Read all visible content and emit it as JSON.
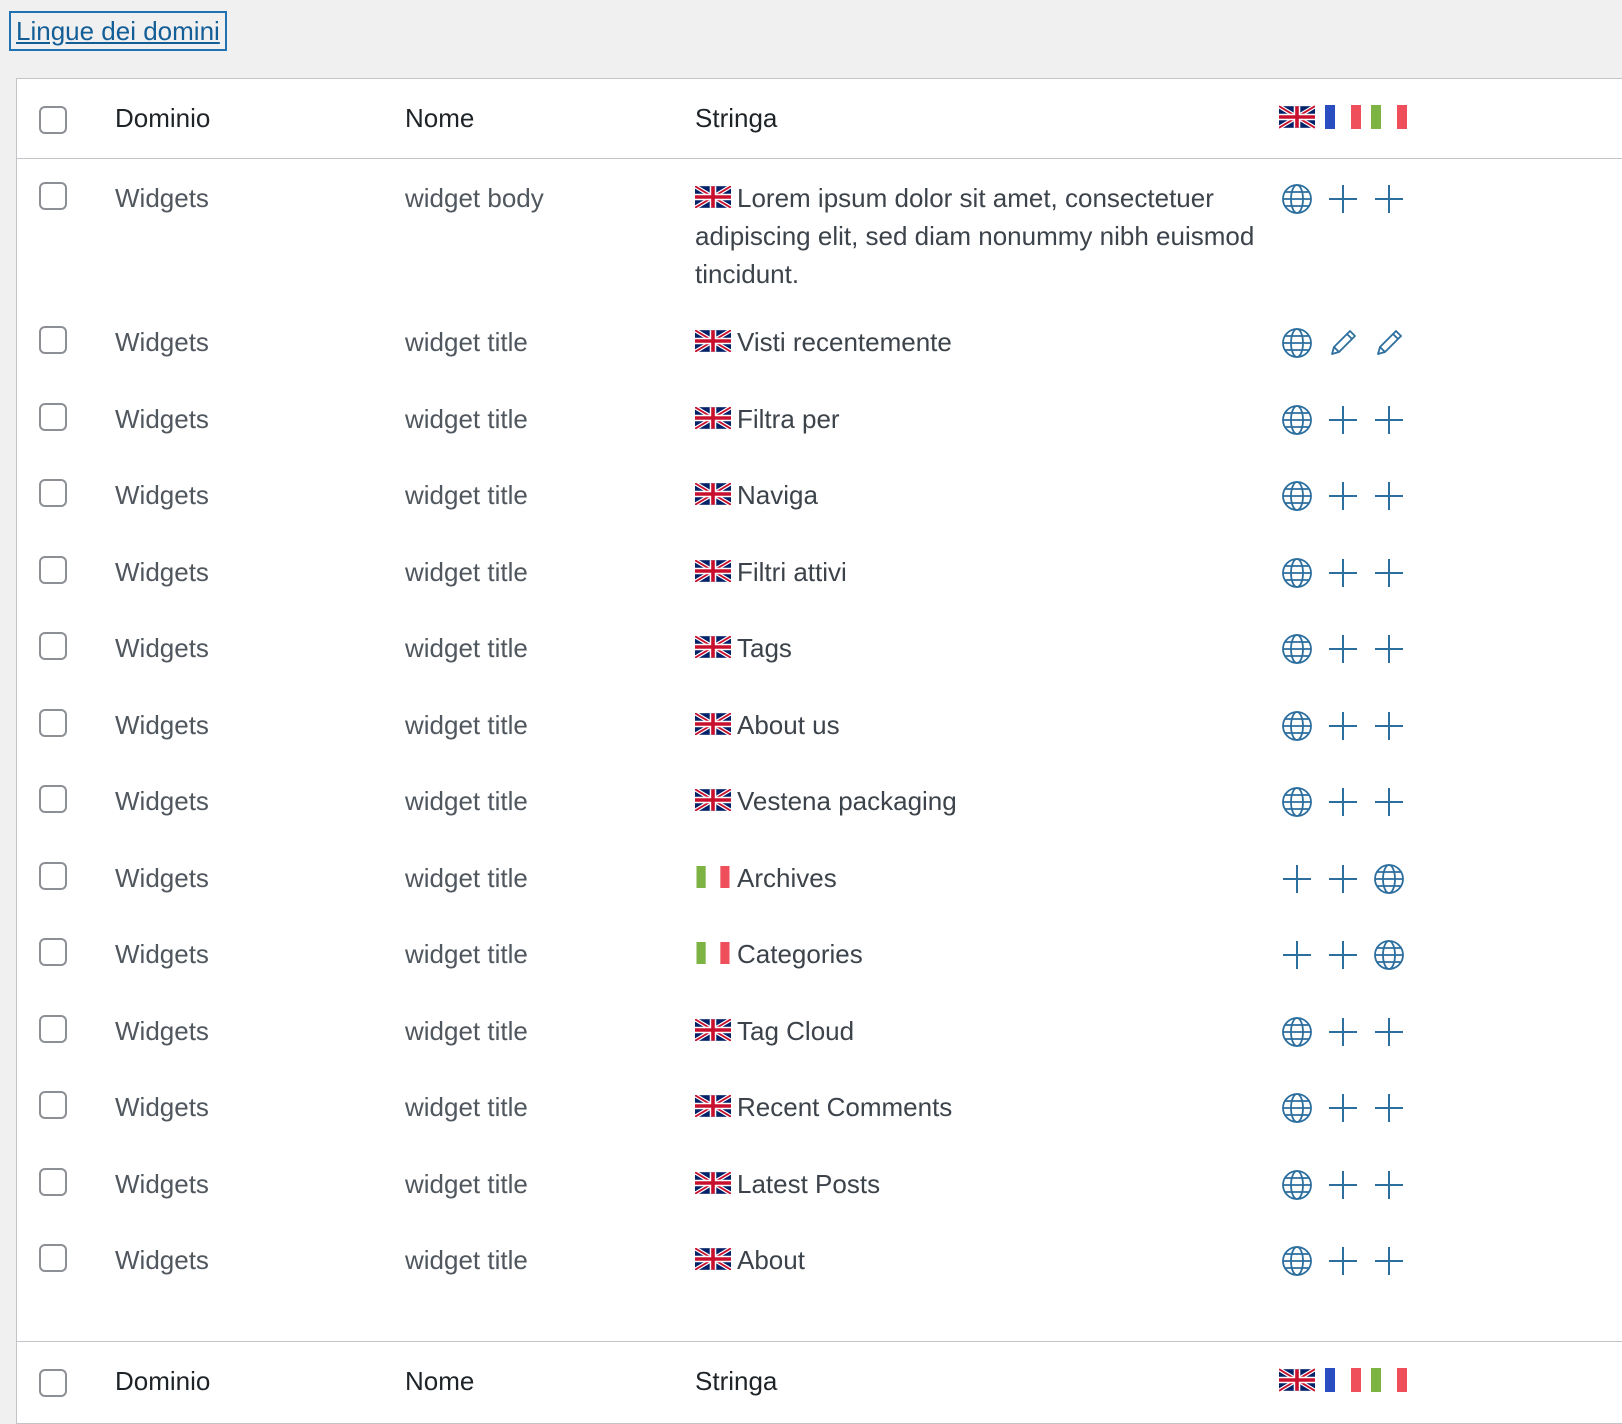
{
  "top_link": "Lingue dei domini",
  "columns": {
    "dominio": "Dominio",
    "nome": "Nome",
    "stringa": "Stringa"
  },
  "header_flags": [
    "uk-flag-icon",
    "france-flag-icon",
    "italy-flag-icon"
  ],
  "colors": {
    "accent": "#2271b1",
    "link": "#135e96",
    "border": "#c3c4c7"
  },
  "rows": [
    {
      "dominio": "Widgets",
      "nome": "widget body",
      "flag": "uk",
      "stringa": "Lorem ipsum dolor sit amet, consectetuer adipiscing elit, sed diam nonummy nibh euismod tincidunt.",
      "actions": [
        "globe",
        "plus",
        "plus"
      ]
    },
    {
      "dominio": "Widgets",
      "nome": "widget title",
      "flag": "uk",
      "stringa": "Visti recentemente",
      "actions": [
        "globe",
        "pencil",
        "pencil"
      ]
    },
    {
      "dominio": "Widgets",
      "nome": "widget title",
      "flag": "uk",
      "stringa": "Filtra per",
      "actions": [
        "globe",
        "plus",
        "plus"
      ]
    },
    {
      "dominio": "Widgets",
      "nome": "widget title",
      "flag": "uk",
      "stringa": "Naviga",
      "actions": [
        "globe",
        "plus",
        "plus"
      ]
    },
    {
      "dominio": "Widgets",
      "nome": "widget title",
      "flag": "uk",
      "stringa": "Filtri attivi",
      "actions": [
        "globe",
        "plus",
        "plus"
      ]
    },
    {
      "dominio": "Widgets",
      "nome": "widget title",
      "flag": "uk",
      "stringa": "Tags",
      "actions": [
        "globe",
        "plus",
        "plus"
      ]
    },
    {
      "dominio": "Widgets",
      "nome": "widget title",
      "flag": "uk",
      "stringa": "About us",
      "actions": [
        "globe",
        "plus",
        "plus"
      ]
    },
    {
      "dominio": "Widgets",
      "nome": "widget title",
      "flag": "uk",
      "stringa": "Vestena packaging",
      "actions": [
        "globe",
        "plus",
        "plus"
      ]
    },
    {
      "dominio": "Widgets",
      "nome": "widget title",
      "flag": "it",
      "stringa": "Archives",
      "actions": [
        "plus",
        "plus",
        "globe"
      ]
    },
    {
      "dominio": "Widgets",
      "nome": "widget title",
      "flag": "it",
      "stringa": "Categories",
      "actions": [
        "plus",
        "plus",
        "globe"
      ]
    },
    {
      "dominio": "Widgets",
      "nome": "widget title",
      "flag": "uk",
      "stringa": "Tag Cloud",
      "actions": [
        "globe",
        "plus",
        "plus"
      ]
    },
    {
      "dominio": "Widgets",
      "nome": "widget title",
      "flag": "uk",
      "stringa": "Recent Comments",
      "actions": [
        "globe",
        "plus",
        "plus"
      ]
    },
    {
      "dominio": "Widgets",
      "nome": "widget title",
      "flag": "uk",
      "stringa": "Latest Posts",
      "actions": [
        "globe",
        "plus",
        "plus"
      ]
    },
    {
      "dominio": "Widgets",
      "nome": "widget title",
      "flag": "uk",
      "stringa": "About",
      "actions": [
        "globe",
        "plus",
        "plus"
      ]
    }
  ]
}
